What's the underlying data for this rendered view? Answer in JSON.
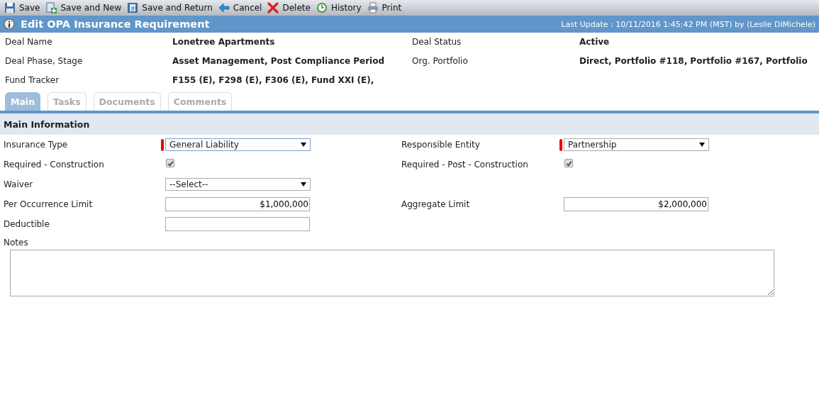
{
  "toolbar": [
    {
      "label": "Save"
    },
    {
      "label": "Save and New"
    },
    {
      "label": "Save and Return"
    },
    {
      "label": "Cancel"
    },
    {
      "label": "Delete"
    },
    {
      "label": "History"
    },
    {
      "label": "Print"
    }
  ],
  "header": {
    "title": "Edit OPA Insurance Requirement",
    "last_update": "Last Update : 10/11/2016 1:45:42 PM (MST) by (Leslie DiMichele)"
  },
  "details": [
    {
      "label": "Deal Name",
      "value": "Lonetree Apartments"
    },
    {
      "label": "Deal Status",
      "value": "Active"
    },
    {
      "label": "Deal Phase, Stage",
      "value": "Asset Management, Post Compliance Period"
    },
    {
      "label": "Org. Portfolio",
      "value": "Direct, Portfolio #118, Portfolio #167, Portfolio"
    },
    {
      "label": "Fund Tracker",
      "value": "F155 (E), F298 (E), F306 (E), Fund XXI (E),"
    }
  ],
  "tabs": [
    {
      "label": "Main",
      "selected": true
    },
    {
      "label": "Tasks",
      "selected": false
    },
    {
      "label": "Documents",
      "selected": false
    },
    {
      "label": "Comments",
      "selected": false
    }
  ],
  "section": {
    "title": "Main Information"
  },
  "rows": [
    [
      {
        "label": "Insurance Type",
        "kind": "select",
        "value": "General Liability",
        "required": true,
        "focused": true
      },
      {
        "label": "Responsible Entity",
        "kind": "select",
        "value": "Partnership",
        "required": true,
        "focused": false
      }
    ],
    [
      {
        "label": "Required - Construction",
        "kind": "checkbox",
        "checked": true
      },
      {
        "label": "Required - Post - Construction",
        "kind": "checkbox",
        "checked": true
      }
    ],
    [
      {
        "label": "Waiver",
        "kind": "select",
        "value": "--Select--",
        "required": false,
        "focused": false
      }
    ],
    [
      {
        "label": "Per Occurrence Limit",
        "kind": "text",
        "value": "$1,000,000"
      },
      {
        "label": "Aggregate Limit",
        "kind": "text",
        "value": "$2,000,000"
      }
    ],
    [
      {
        "label": "Deductible",
        "kind": "text"
      }
    ]
  ],
  "notes": {
    "label": "Notes"
  }
}
